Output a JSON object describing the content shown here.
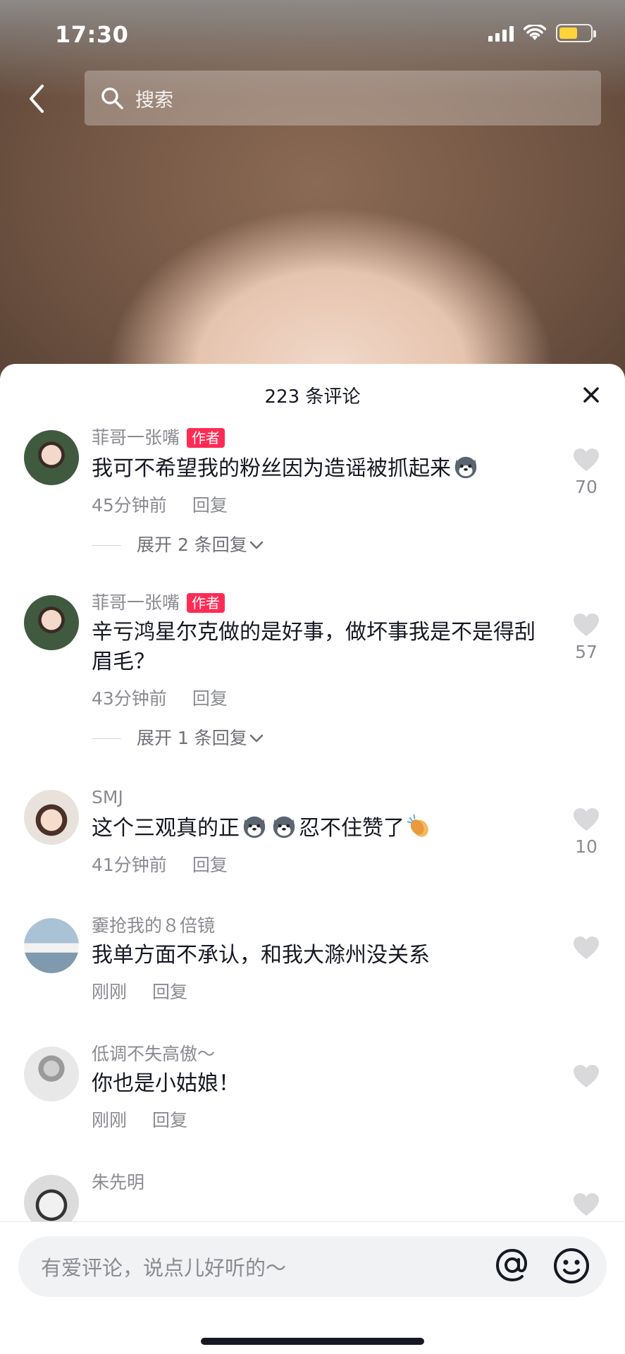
{
  "status_bar": {
    "time": "17:30",
    "battery_color": "#ffd43b"
  },
  "search": {
    "placeholder": "搜索"
  },
  "comments_header": {
    "title": "223 条评论"
  },
  "comments": [
    {
      "username": "菲哥一张嘴",
      "badge": "作者",
      "text": "我可不希望我的粉丝因为造谣被抓起来",
      "emoji": [
        "husky-emoji"
      ],
      "time": "45分钟前",
      "reply_label": "回复",
      "likes": "70",
      "expand": "展开 2 条回复"
    },
    {
      "username": "菲哥一张嘴",
      "badge": "作者",
      "text": "辛亏鸿星尔克做的是好事，做坏事我是不是得刮眉毛？",
      "time": "43分钟前",
      "reply_label": "回复",
      "likes": "57",
      "expand": "展开 1 条回复"
    },
    {
      "username": "SMJ",
      "text_before": "这个三观真的正",
      "text_after": "忍不住赞了",
      "emoji": [
        "husky-emoji",
        "husky-emoji",
        "clap-emoji"
      ],
      "time": "41分钟前",
      "reply_label": "回复",
      "likes": "10"
    },
    {
      "username": "嫑抢我的８倍镜",
      "text": "我单方面不承认，和我大滁州没关系",
      "time": "刚刚",
      "reply_label": "回复",
      "likes": ""
    },
    {
      "username": "低调不失高傲～",
      "text": "你也是小姑娘！",
      "time": "刚刚",
      "reply_label": "回复",
      "likes": ""
    },
    {
      "username": "朱先明",
      "text": "",
      "time": "",
      "reply_label": "",
      "likes": ""
    }
  ],
  "input": {
    "placeholder": "有爱评论，说点儿好听的～"
  },
  "colors": {
    "accent": "#fe2c55",
    "text": "#161823",
    "muted": "#8a8b91"
  }
}
